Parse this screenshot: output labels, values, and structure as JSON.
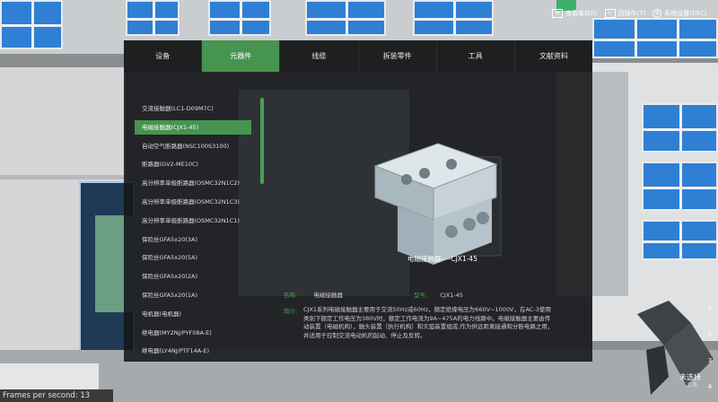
{
  "toolbar": {
    "items": [
      {
        "label": "查看库存(I)",
        "icon": "inventory-icon"
      },
      {
        "label": "回操作(T)",
        "icon": "return-icon"
      },
      {
        "label": "系统设置(ESC)",
        "icon": "settings-icon"
      }
    ]
  },
  "tabs": [
    {
      "label": "设备",
      "active": false
    },
    {
      "label": "元器件",
      "active": true
    },
    {
      "label": "线缆",
      "active": false
    },
    {
      "label": "拆装零件",
      "active": false
    },
    {
      "label": "工具",
      "active": false
    },
    {
      "label": "文献资料",
      "active": false
    }
  ],
  "components": [
    {
      "label": "交流接触器(LC1-D09M7C)"
    },
    {
      "label": "电磁接触器(CJX1-45)"
    },
    {
      "label": "自动空气断路器(NSC100S3100)"
    },
    {
      "label": "断路器(GV2-ME10C)"
    },
    {
      "label": "高分辨率单极断路器(OSMC32N1C2)"
    },
    {
      "label": "高分辨率单极断路器(OSMC32N1C3)"
    },
    {
      "label": "高分辨率单极断路器(OSMC32N1C1)"
    },
    {
      "label": "保险丝GFA5x20(3A)"
    },
    {
      "label": "保险丝GFA5x20(5A)"
    },
    {
      "label": "保险丝GFA5x20(2A)"
    },
    {
      "label": "保险丝GFA5x20(1A)"
    },
    {
      "label": "电机器(电机器)"
    },
    {
      "label": "继电器(MY2NJ/PYF08A-E)"
    },
    {
      "label": "继电器(LY4NJ/PTF14A-E)"
    }
  ],
  "selected_index": 1,
  "detail": {
    "title": "电磁接触器----CJX1-45",
    "name_label": "名称:",
    "name_value": "电磁接触器",
    "model_label": "型号:",
    "model_value": "CJX1-45",
    "intro_label": "简介:",
    "intro_text": "CJX1系列电磁接触器主要用于交流50Hz或60Hz，额定绝缘电压为660V~1000V，在AC-3使用类别下额定工作电压为380V时，额定工作电流为9A~475A的电力线路中。电磁接触器主要由传动装置（电磁机构），触头装置（执行机构）和灭弧装置组成,作为供远距离接通和分断电路之用，并适用于控制交流电动机的起动、停止及反转。"
  },
  "status": {
    "fps": "Frames per second: 13",
    "unselected": "未选择",
    "unselected_sub": "工具"
  },
  "side_numbers": [
    "1",
    "2",
    "3",
    "4"
  ],
  "colors": {
    "accent": "#46944f",
    "panel_bg": "#141618",
    "window_blue": "#2f7fd4"
  }
}
